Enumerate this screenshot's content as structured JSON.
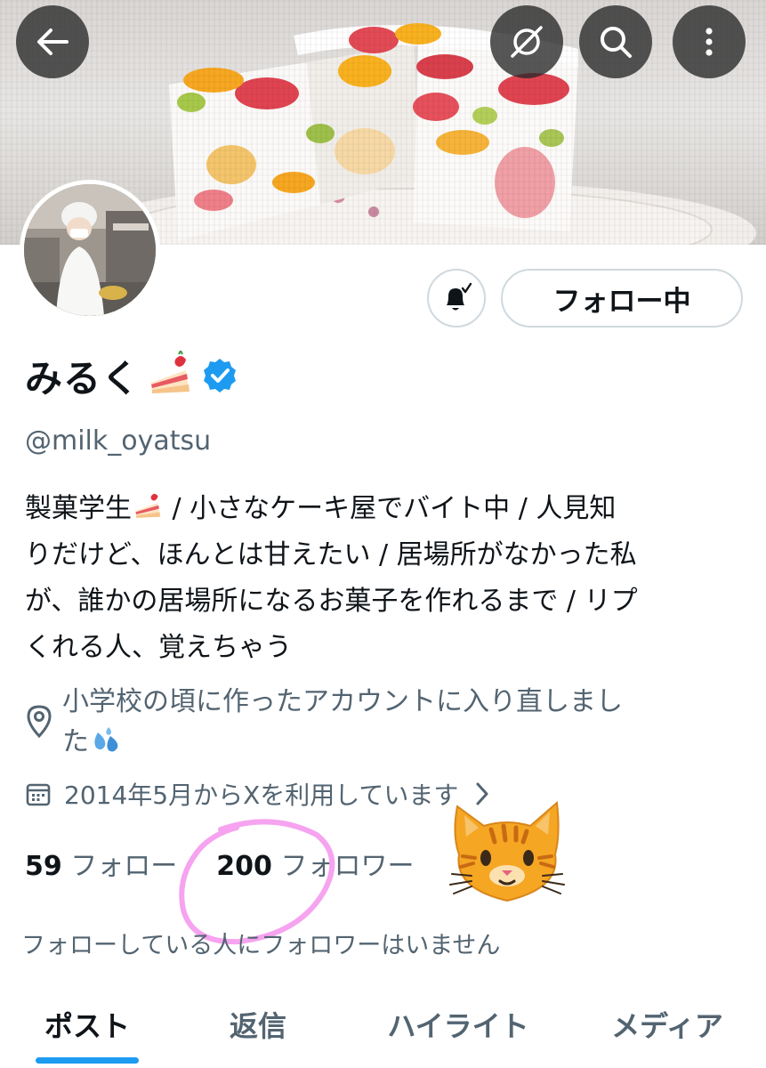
{
  "colors": {
    "accent": "#1d9bf0",
    "primary_text": "#0f1419",
    "secondary_text": "#536471",
    "annotation_circle": "#f6a3f0"
  },
  "header": {
    "back_icon": "arrow-left-icon",
    "grok_icon": "grok-icon",
    "search_icon": "search-icon",
    "more_icon": "more-vertical-icon"
  },
  "profile": {
    "follow_button_label": "フォロー中",
    "notify_icon": "bell-check-icon",
    "display_name": "みるく",
    "name_emoji": "shortcake-emoji",
    "verified_icon": "verified-badge-icon",
    "handle": "@milk_oyatsu",
    "bio_lines": [
      "製菓学生",
      " / 小さなケーキ屋でバイト中 / 人見知",
      "りだけど、ほんとは甘えたい / 居場所がなかった私",
      "が、誰かの居場所になるお菓子を作れるまで / リプ",
      "くれる人、覚えちゃう"
    ],
    "location_icon": "location-pin-icon",
    "location_lines": [
      "小学校の頃に作ったアカウントに入り直しまし",
      "た"
    ],
    "location_emoji": "sweat-droplets-emoji",
    "joined_icon": "calendar-icon",
    "joined_text": "2014年5月からXを利用しています",
    "following_count": "59",
    "following_label": "フォロー",
    "followers_count": "200",
    "followers_label": "フォロワー",
    "sticker": "cat-face-emoji",
    "followed_by_note": "フォローしている人にフォロワーはいません"
  },
  "tabs": [
    "ポスト",
    "返信",
    "ハイライト",
    "メディア"
  ],
  "active_tab": "ポスト"
}
